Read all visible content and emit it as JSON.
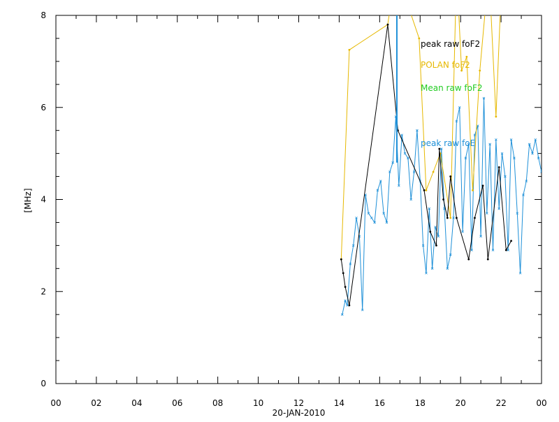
{
  "chart_data": {
    "type": "line",
    "xlabel": "20-JAN-2010",
    "ylabel": "[MHz]",
    "ylim": [
      0,
      8
    ],
    "xlim": [
      0,
      24
    ],
    "x_ticks": [
      0,
      2,
      4,
      6,
      8,
      10,
      12,
      14,
      16,
      18,
      20,
      22,
      24
    ],
    "x_tick_labels": [
      "00",
      "02",
      "04",
      "06",
      "08",
      "10",
      "12",
      "14",
      "16",
      "18",
      "20",
      "22",
      "00"
    ],
    "y_ticks": [
      0,
      2,
      4,
      6,
      8
    ],
    "y_tick_labels": [
      "0",
      "2",
      "4",
      "6",
      "8"
    ],
    "grid": false,
    "legend_position": "top-right",
    "series": [
      {
        "name": "peak raw foF2",
        "color": "#000000",
        "x": [
          14.1,
          14.2,
          14.3,
          14.5,
          16.4,
          16.9,
          18.2,
          18.5,
          18.8,
          18.95,
          19.15,
          19.35,
          19.5,
          19.8,
          20.4,
          20.7,
          21.1,
          21.35,
          21.9,
          22.25,
          22.5
        ],
        "y": [
          2.7,
          2.4,
          2.1,
          1.7,
          7.8,
          5.5,
          4.2,
          3.3,
          3.0,
          5.1,
          4.0,
          3.6,
          4.5,
          3.6,
          2.7,
          3.6,
          4.3,
          2.7,
          4.7,
          2.9,
          3.1
        ]
      },
      {
        "name": "POLAN foF2",
        "color": "#e6b800",
        "x": [
          14.1,
          14.5,
          16.4,
          16.8,
          17.95,
          18.3,
          18.65,
          19.0,
          19.5,
          19.8,
          20.05,
          20.3,
          20.6,
          20.95,
          21.4,
          21.75,
          22.05
        ],
        "y": [
          2.7,
          7.25,
          7.8,
          9.0,
          7.5,
          4.2,
          4.6,
          5.0,
          3.6,
          9.0,
          6.8,
          7.1,
          4.2,
          6.8,
          9.0,
          5.8,
          9.0
        ]
      },
      {
        "name": "Mean raw foF2",
        "color": "#22cc22",
        "x": [],
        "y": []
      },
      {
        "name": "peak raw foE",
        "color": "#1e90d8",
        "x": [
          14.15,
          14.3,
          14.4,
          14.55,
          14.7,
          14.85,
          15.0,
          15.15,
          15.3,
          15.45,
          15.6,
          15.75,
          15.9,
          16.05,
          16.2,
          16.35,
          16.5,
          16.65,
          16.8,
          16.95,
          17.1,
          17.25,
          17.4,
          17.55,
          17.7,
          17.85,
          18.0,
          18.15,
          18.3,
          18.45,
          18.6,
          18.75,
          18.9,
          19.05,
          19.2,
          19.35,
          19.5,
          19.65,
          19.8,
          19.95,
          20.1,
          20.25,
          20.4,
          20.55,
          20.7,
          20.85,
          21.0,
          21.15,
          21.3,
          21.45,
          21.6,
          21.75,
          21.9,
          22.05,
          22.2,
          22.35,
          22.5,
          22.65,
          22.8,
          22.95,
          23.1,
          23.25,
          23.4,
          23.55,
          23.7,
          23.85,
          24.0
        ],
        "y": [
          1.5,
          1.8,
          1.7,
          2.6,
          3.0,
          3.6,
          3.2,
          1.6,
          4.1,
          3.7,
          3.6,
          3.5,
          4.2,
          4.4,
          3.7,
          3.5,
          4.6,
          4.8,
          5.8,
          4.3,
          5.4,
          5.0,
          4.9,
          4.0,
          4.6,
          5.5,
          4.4,
          3.0,
          2.4,
          3.8,
          2.5,
          3.4,
          3.2,
          5.1,
          3.8,
          2.5,
          2.8,
          3.6,
          5.7,
          6.0,
          3.3,
          4.9,
          5.2,
          2.9,
          5.4,
          5.6,
          3.2,
          6.2,
          3.7,
          5.2,
          2.9,
          5.3,
          3.8,
          5.0,
          4.5,
          2.9,
          5.3,
          4.9,
          3.7,
          2.4,
          4.1,
          4.4,
          5.2,
          5.0,
          5.3,
          4.9,
          4.6
        ]
      }
    ],
    "vertical_marker": {
      "x": 16.85,
      "color": "#1e90d8"
    }
  }
}
